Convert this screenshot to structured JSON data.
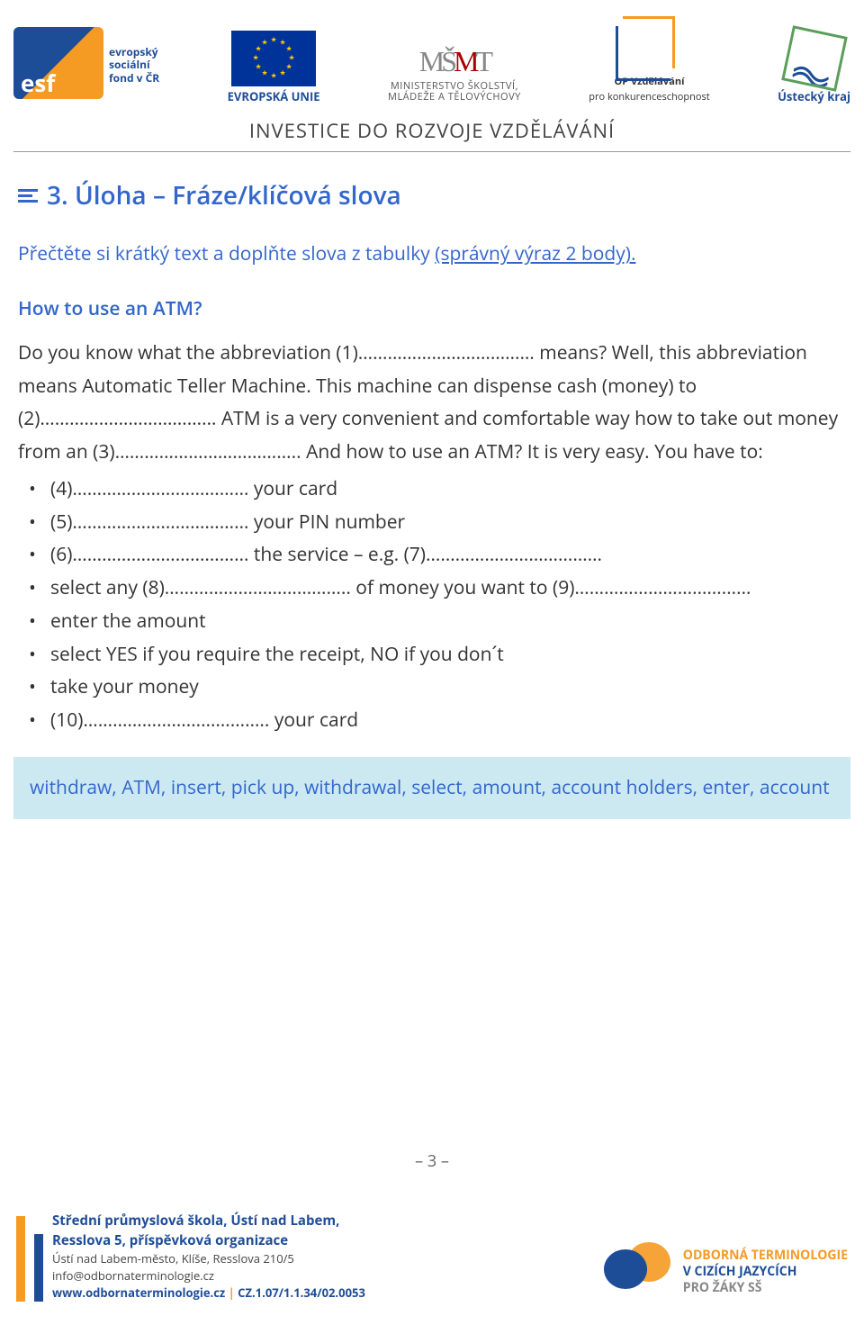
{
  "header": {
    "esf_abbrev": "esf",
    "esf_text": "evropský\nsociální\nfond v ČR",
    "eu_label": "EVROPSKÁ UNIE",
    "msmt_line1": "MINISTERSTVO ŠKOLSTVÍ,",
    "msmt_line2": "MLÁDEŽE A TĚLOVÝCHOVY",
    "opvk_line1": "OP Vzdělávání",
    "opvk_line2": "pro konkurenceschopnost",
    "ustecky": "Ústecký kraj",
    "investice": "INVESTICE DO ROZVOJE VZDĚLÁVÁNÍ"
  },
  "section": {
    "number_title": "3. Úloha – Fráze/klíčová slova",
    "instruction_prefix": "Přečtěte si krátký text a doplňte slova z tabulky ",
    "instruction_underlined": "(správný výraz 2 body).",
    "exercise_title": "How to use an ATM?",
    "paragraph": "Do you know what the abbreviation (1)……………………………… means? Well, this abbreviation means Automatic Teller Machine. This machine can dispense cash (money) to (2)……………………………… ATM is a very convenient and comfortable way how to take out money from an (3)……………………………….. And how to use an ATM? It is very easy. You have to:",
    "bullets": [
      "(4)……………………………… your card",
      "(5)……………………………… your PIN number",
      "(6)……………………………… the service – e.g. (7)………………………………",
      "select any (8)……………………………….. of money you want to (9)………………………………",
      "enter the amount",
      "select YES if you require the receipt, NO if you don´t",
      "take your money",
      "(10)……………………………….. your card"
    ],
    "word_bank": "withdraw, ATM, insert, pick up, withdrawal, select, amount, account holders, enter, account"
  },
  "page_number": "– 3 –",
  "footer": {
    "school_line1": "Střední průmyslová škola, Ústí nad Labem,",
    "school_line2": "Resslova 5, příspěvková organizace",
    "address": "Ústí nad Labem-město, Klíše, Resslova 210/5",
    "email": "info@odbornaterminologie.cz",
    "web": "www.odbornaterminologie.cz",
    "sep": " | ",
    "code": "CZ.1.07/1.1.34/02.0053",
    "right_l1": "ODBORNÁ TERMINOLOGIE",
    "right_l2": "V CIZÍCH JAZYCÍCH",
    "right_l3": "PRO ŽÁKY SŠ"
  }
}
